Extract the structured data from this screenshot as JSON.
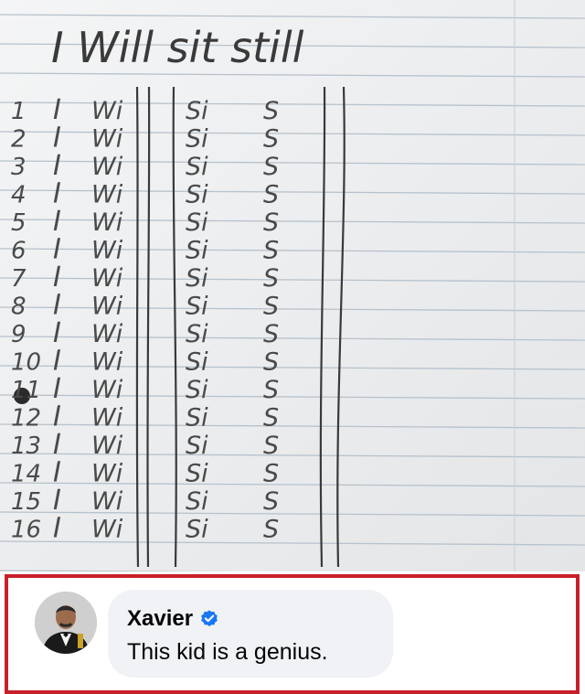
{
  "photo": {
    "header_line": "I Will sit still",
    "line_numbers": [
      "1",
      "2",
      "3",
      "4",
      "5",
      "6",
      "7",
      "8",
      "9",
      "10",
      "11",
      "12",
      "13",
      "14",
      "15",
      "16"
    ],
    "row_words": [
      "I",
      "Wi",
      "Si",
      "S"
    ]
  },
  "comment": {
    "author": "Xavier",
    "verified_icon": "verified-badge-icon",
    "text": "This kid is a genius.",
    "colors": {
      "border": "#c8202a",
      "badge": "#1877f2",
      "bubble": "#f0f2f5"
    }
  }
}
